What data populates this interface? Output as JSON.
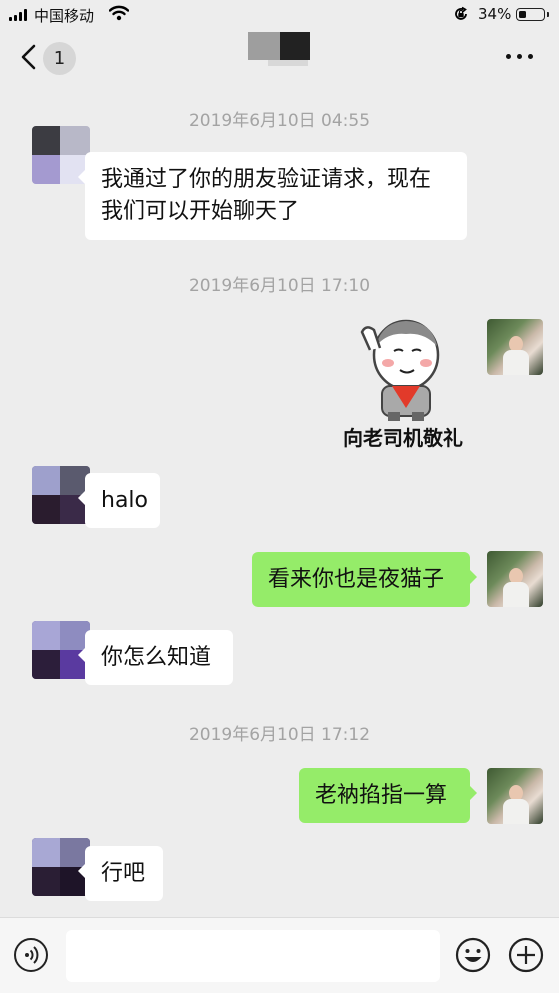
{
  "status_bar": {
    "carrier": "中国移动",
    "battery_percent": "34%",
    "battery_level": 0.34,
    "icons": [
      "signal-icon",
      "wifi-icon",
      "rotation-lock-icon",
      "battery-icon"
    ]
  },
  "nav": {
    "unread_count": "1",
    "icons": [
      "back-arrow-icon",
      "more-icon"
    ]
  },
  "messages": [
    {
      "type": "timestamp",
      "text": "2019年6月10日 04:55"
    },
    {
      "type": "text",
      "side": "left",
      "text_lines": [
        "我通过了你的朋友验证请求，现在",
        "我们可以开始聊天了"
      ]
    },
    {
      "type": "timestamp",
      "text": "2019年6月10日 17:10"
    },
    {
      "type": "sticker",
      "side": "right",
      "caption": "向老司机敬礼"
    },
    {
      "type": "text",
      "side": "left",
      "text": "halo"
    },
    {
      "type": "text",
      "side": "right",
      "text": "看来你也是夜猫子"
    },
    {
      "type": "text",
      "side": "left",
      "text": "你怎么知道"
    },
    {
      "type": "timestamp",
      "text": "2019年6月10日 17:12"
    },
    {
      "type": "text",
      "side": "right",
      "text": "老衲掐指一算"
    },
    {
      "type": "text",
      "side": "left",
      "text": "行吧"
    }
  ],
  "input_bar": {
    "value": "",
    "icons": [
      "voice-icon",
      "emoji-icon",
      "plus-icon"
    ]
  },
  "colors": {
    "background": "#ededed",
    "outgoing_bubble": "#95ec69",
    "incoming_bubble": "#ffffff",
    "timestamp_text": "#a3a3a3"
  }
}
